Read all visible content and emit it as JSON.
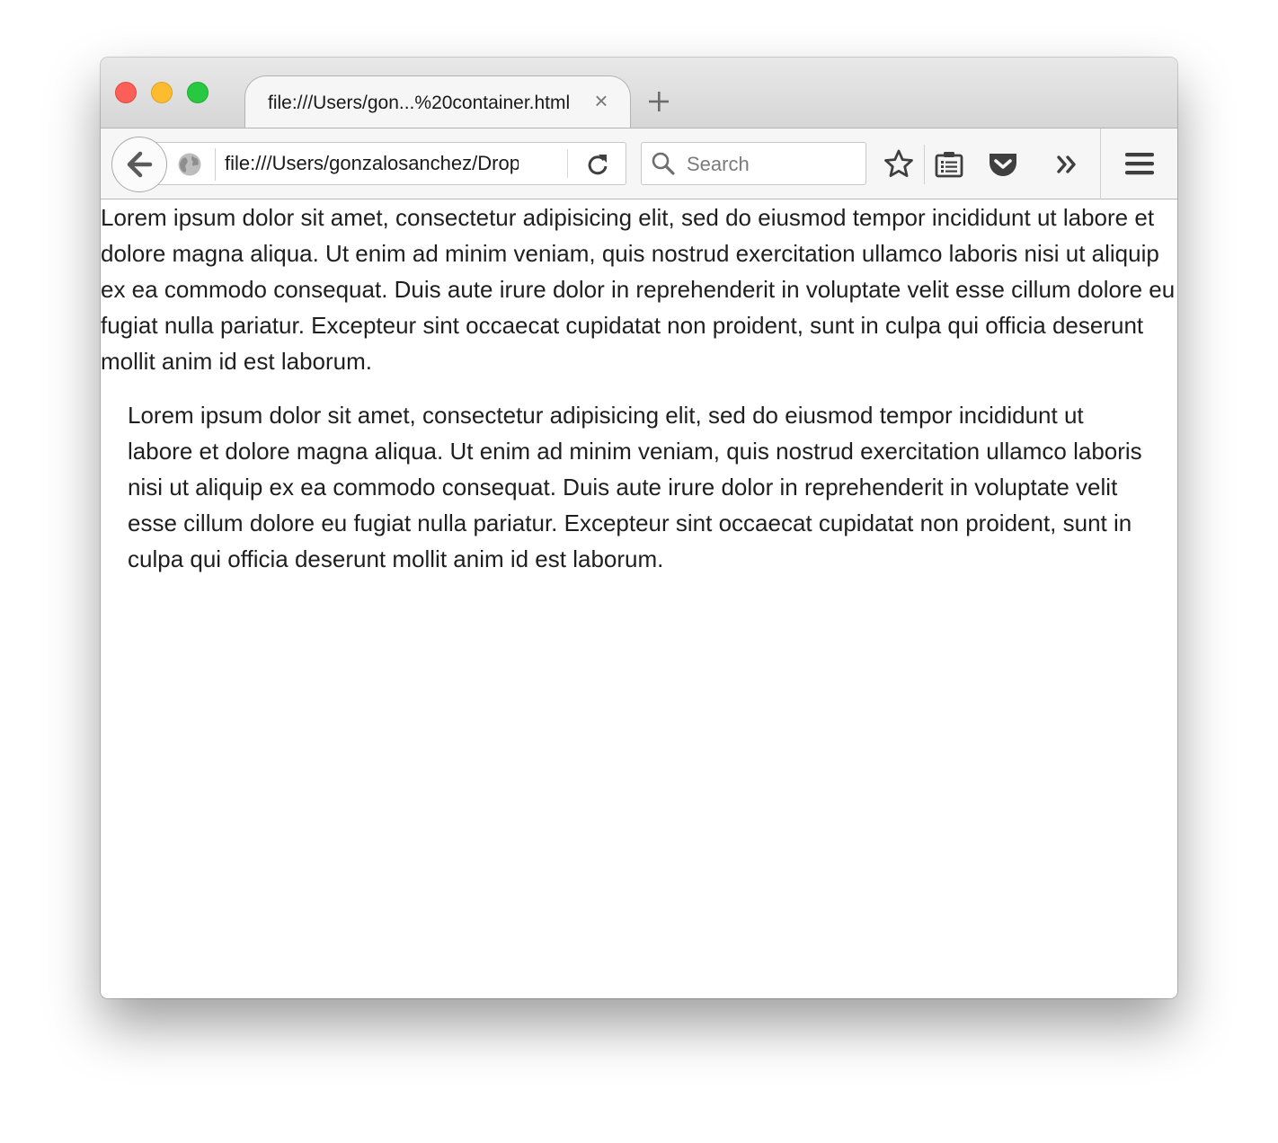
{
  "window": {
    "buttons": [
      "close",
      "minimize",
      "maximize"
    ]
  },
  "tabs": [
    {
      "title": "file:///Users/gon...%20container.html",
      "close_label": "×"
    }
  ],
  "navbar": {
    "url": "file:///Users/gonzalosanchez/Dropbox/container.html",
    "search_placeholder": "Search",
    "icons": [
      "back-icon",
      "globe-icon",
      "reload-icon",
      "search-icon",
      "bookmark-star-icon",
      "reading-list-icon",
      "pocket-icon",
      "overflow-chevron-icon",
      "hamburger-menu-icon"
    ]
  },
  "content": {
    "paragraph_outside": "Lorem ipsum dolor sit amet, consectetur adipisicing elit, sed do eiusmod tempor incididunt ut labore et dolore magna aliqua. Ut enim ad minim veniam, quis nostrud exercitation ullamco laboris nisi ut aliquip ex ea commodo consequat. Duis aute irure dolor in reprehenderit in voluptate velit esse cillum dolore eu fugiat nulla pariatur. Excepteur sint occaecat cupidatat non proident, sunt in culpa qui officia deserunt mollit anim id est laborum.",
    "paragraph_container": "Lorem ipsum dolor sit amet, consectetur adipisicing elit, sed do eiusmod tempor incididunt ut labore et dolore magna aliqua. Ut enim ad minim veniam, quis nostrud exercitation ullamco laboris nisi ut aliquip ex ea commodo consequat. Duis aute irure dolor in reprehenderit in voluptate velit esse cillum dolore eu fugiat nulla pariatur. Excepteur sint occaecat cupidatat non proident, sunt in culpa qui officia deserunt mollit anim id est laborum."
  },
  "colors": {
    "close": "#fc5f57",
    "minimize": "#fdbc2e",
    "maximize": "#28c840",
    "toolbar_bg": "#f6f6f6",
    "icon": "#4a4a4a"
  }
}
